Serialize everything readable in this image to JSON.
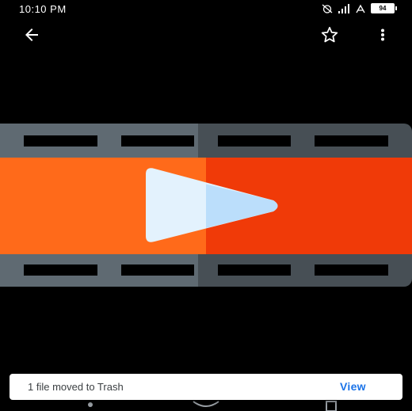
{
  "status_bar": {
    "time": "10:10 PM",
    "battery": "94",
    "icons": [
      "alarm-off-icon",
      "signal-icon",
      "data-icon",
      "battery-icon"
    ]
  },
  "toolbar": {
    "back_icon": "arrow-back-icon",
    "favorite_icon": "star-outline-icon",
    "more_icon": "more-vert-icon"
  },
  "preview": {
    "icon": "video-file-icon",
    "colors": {
      "film_left": "#5f6a72",
      "film_right": "#474f55",
      "band_left": "#ff6a1a",
      "band_right": "#f03a08",
      "play_left": "#e3f2fd",
      "play_right": "#bbdefb"
    }
  },
  "snackbar": {
    "message": "1 file moved to Trash",
    "action": "View",
    "action_color": "#1a73e8"
  }
}
